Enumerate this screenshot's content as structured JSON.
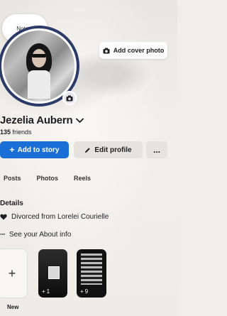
{
  "note": {
    "placeholder": "Note..."
  },
  "profile": {
    "name": "Jezelia Aubern",
    "friends_count": "135",
    "friends_label": "friends"
  },
  "cover": {
    "button_label": "Add cover photo"
  },
  "actions": {
    "add_story_label": "Add to story",
    "edit_profile_label": "Edit profile",
    "more_label": "..."
  },
  "tabs": [
    {
      "label": "Posts"
    },
    {
      "label": "Photos"
    },
    {
      "label": "Reels"
    }
  ],
  "details": {
    "title": "Details",
    "relationship": "Divorced from Lorelei Courielle",
    "about_link": "See your About info"
  },
  "highlights": {
    "new_label": "New",
    "new_symbol": "+",
    "album1_count": "1",
    "album2_count": "9"
  },
  "colors": {
    "accent": "#1a6fd6",
    "avatar_ring": "#2b3a67"
  }
}
